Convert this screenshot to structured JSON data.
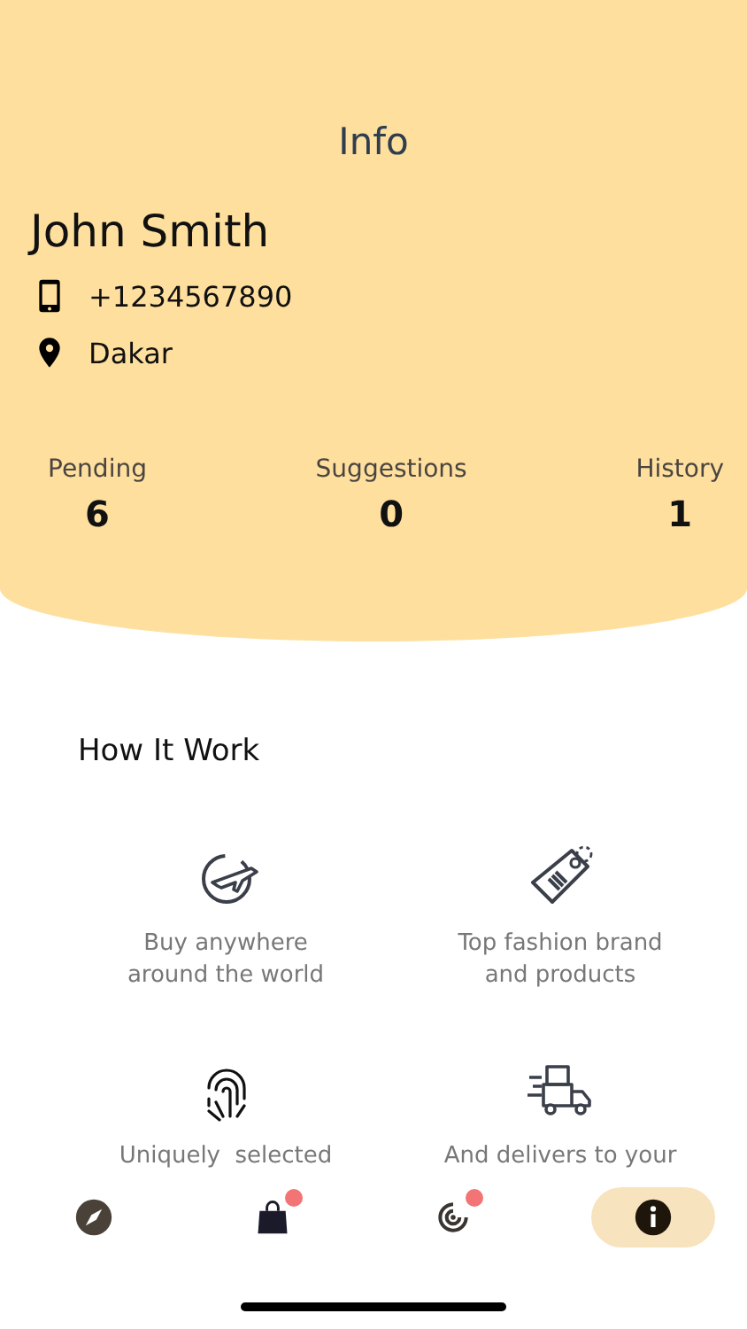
{
  "header": {
    "title": "Info",
    "name": "John Smith",
    "phone": "+1234567890",
    "city": "Dakar"
  },
  "stats": [
    {
      "label": "Pending",
      "value": "6"
    },
    {
      "label": "Suggestions",
      "value": "0"
    },
    {
      "label": "History",
      "value": "1"
    }
  ],
  "how_it_works": {
    "title": "How It Work",
    "steps": [
      {
        "kind": "plane",
        "text": "Buy anywhere around the world"
      },
      {
        "kind": "tag",
        "text": "Top fashion brand and products"
      },
      {
        "kind": "fingerprint",
        "text": "Uniquely  selected"
      },
      {
        "kind": "truck",
        "text": "And delivers to your"
      }
    ]
  },
  "nav": [
    {
      "kind": "compass",
      "selected": false,
      "badge": false
    },
    {
      "kind": "bag",
      "selected": false,
      "badge": true
    },
    {
      "kind": "radar",
      "selected": false,
      "badge": true
    },
    {
      "kind": "info",
      "selected": true,
      "badge": false
    }
  ]
}
